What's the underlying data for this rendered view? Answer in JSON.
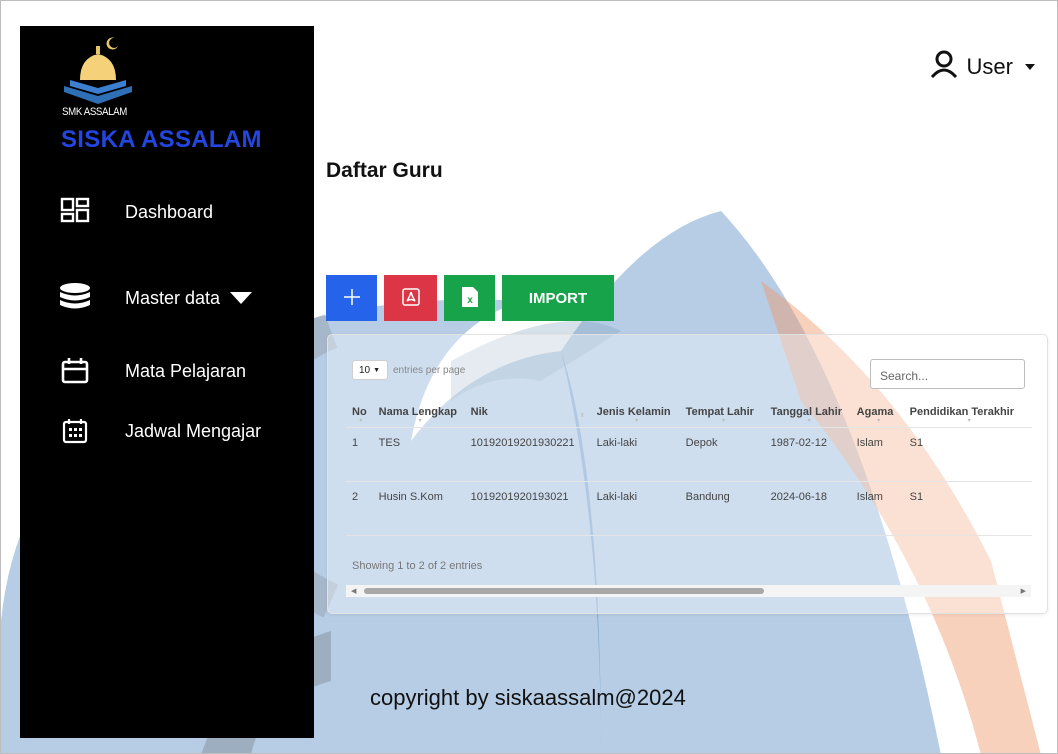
{
  "brand": {
    "logo_caption": "SMK ASSALAM",
    "name": "SISKA ASSALAM"
  },
  "sidebar": {
    "items": [
      {
        "label": "Dashboard",
        "icon": "dashboard-grid-icon"
      },
      {
        "label": "Master data",
        "icon": "database-icon"
      },
      {
        "label": "Mata Pelajaran",
        "icon": "calendar-icon"
      },
      {
        "label": "Jadwal Mengajar",
        "icon": "calendar-grid-icon"
      }
    ]
  },
  "header": {
    "user_label": "User"
  },
  "page": {
    "title": "Daftar Guru"
  },
  "toolbar": {
    "import_label": "IMPORT",
    "colors": {
      "add": "#2563eb",
      "pdf": "#dc3545",
      "excel": "#16a34a",
      "import": "#16a34a"
    }
  },
  "table_controls": {
    "per_page_value": "10",
    "per_page_label": "entries per page",
    "search_placeholder": "Search..."
  },
  "table": {
    "columns": [
      "No",
      "Nama Lengkap",
      "Nik",
      "Jenis Kelamin",
      "Tempat Lahir",
      "Tanggal Lahir",
      "Agama",
      "Pendidikan Terakhir"
    ],
    "rows": [
      [
        "1",
        "TES",
        "10192019201930221",
        "Laki-laki",
        "Depok",
        "1987-02-12",
        "Islam",
        "S1"
      ],
      [
        "2",
        "Husin S.Kom",
        "1019201920193021",
        "Laki-laki",
        "Bandung",
        "2024-06-18",
        "Islam",
        "S1"
      ]
    ],
    "info": "Showing 1 to 2 of 2 entries"
  },
  "footer": {
    "text": "copyright by siskaassalm@2024"
  }
}
